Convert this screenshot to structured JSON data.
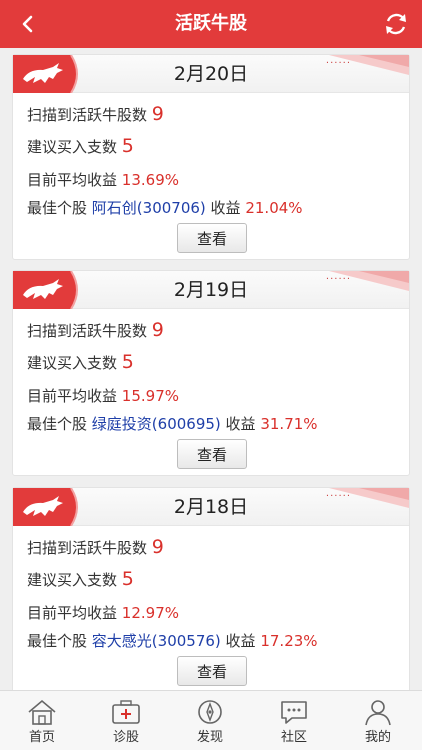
{
  "header": {
    "title": "活跃牛股"
  },
  "cards": [
    {
      "date": "2月20日",
      "scan_label": "扫描到活跃牛股数",
      "scan_count": "9",
      "buy_label": "建议买入支数",
      "buy_count": "5",
      "avg_label": "目前平均收益",
      "avg_value": "13.69%",
      "best_label": "最佳个股",
      "best_stock": "阿石创(300706)",
      "gain_label": "收益",
      "gain_value": "21.04%",
      "button": "查看"
    },
    {
      "date": "2月19日",
      "scan_label": "扫描到活跃牛股数",
      "scan_count": "9",
      "buy_label": "建议买入支数",
      "buy_count": "5",
      "avg_label": "目前平均收益",
      "avg_value": "15.97%",
      "best_label": "最佳个股",
      "best_stock": "绿庭投资(600695)",
      "gain_label": "收益",
      "gain_value": "31.71%",
      "button": "查看"
    },
    {
      "date": "2月18日",
      "scan_label": "扫描到活跃牛股数",
      "scan_count": "9",
      "buy_label": "建议买入支数",
      "buy_count": "5",
      "avg_label": "目前平均收益",
      "avg_value": "12.97%",
      "best_label": "最佳个股",
      "best_stock": "容大感光(300576)",
      "gain_label": "收益",
      "gain_value": "17.23%",
      "button": "查看"
    }
  ],
  "tabbar": [
    {
      "label": "首页",
      "icon": "home-icon"
    },
    {
      "label": "诊股",
      "icon": "medical-kit-icon"
    },
    {
      "label": "发现",
      "icon": "compass-icon"
    },
    {
      "label": "社区",
      "icon": "chat-icon"
    },
    {
      "label": "我的",
      "icon": "user-icon"
    }
  ],
  "colors": {
    "accent": "#e23b3b",
    "value_red": "#d9302b",
    "stock_blue": "#1f3fa8"
  }
}
